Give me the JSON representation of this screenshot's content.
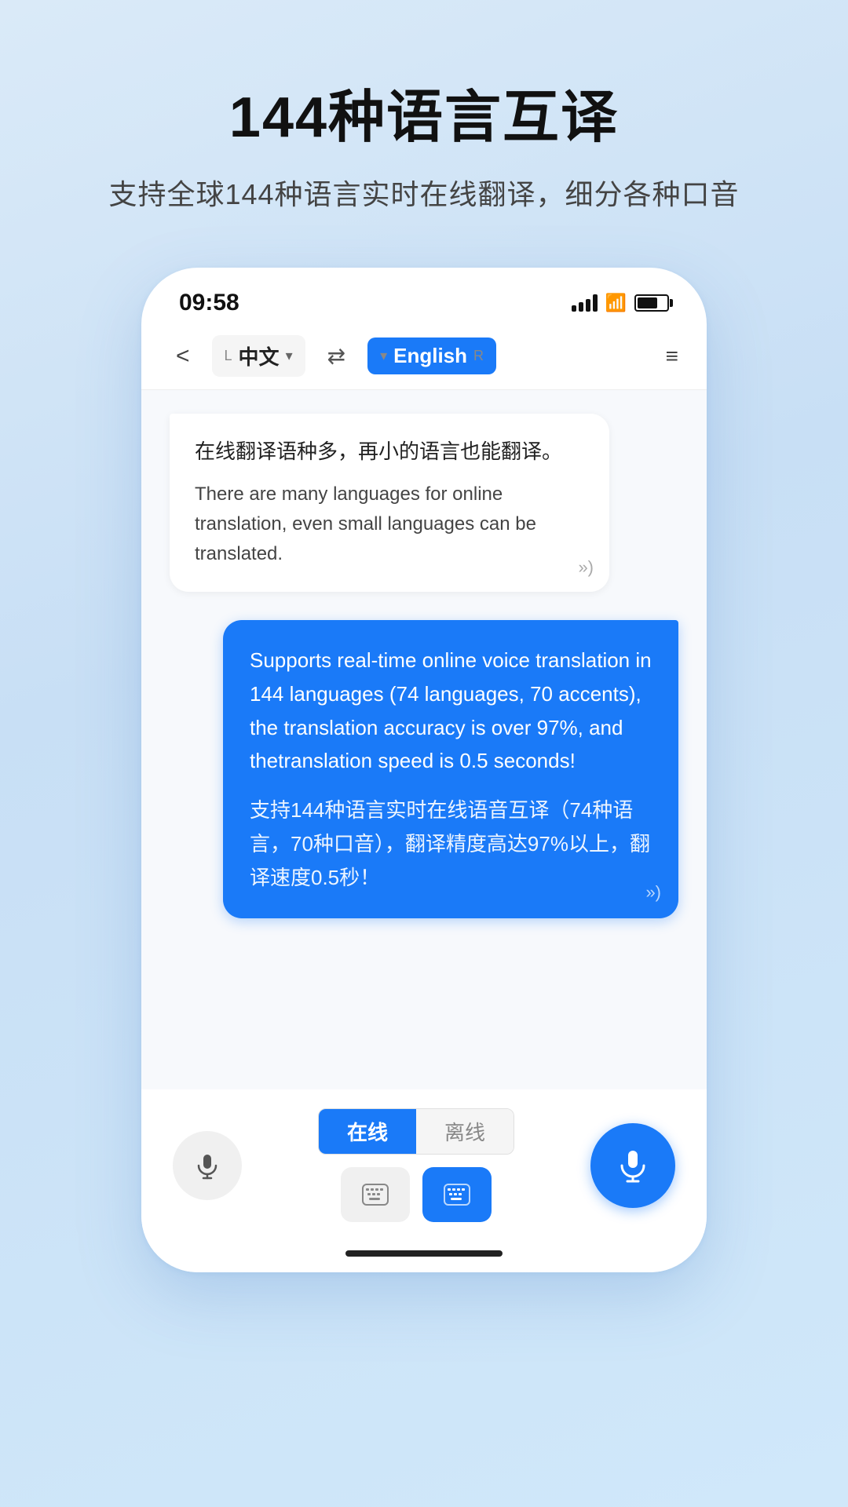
{
  "page": {
    "title": "144种语言互译",
    "subtitle": "支持全球144种语言实时在线翻译，细分各种口音"
  },
  "status_bar": {
    "time": "09:58"
  },
  "nav": {
    "back_label": "<",
    "lang_left_letter": "L",
    "lang_left_name": "中文",
    "swap_label": "⇄",
    "lang_right_letter": "▾",
    "lang_right_name": "English",
    "lang_right_suffix": "R",
    "menu_label": "≡"
  },
  "bubble_left": {
    "chinese": "在线翻译语种多，再小的语言也能翻译。",
    "english": "There are many languages for online translation, even small languages can be translated.",
    "speaker": "»)"
  },
  "bubble_right": {
    "english": "Supports real-time online voice translation in 144 languages (74 languages, 70 accents), the translation accuracy is over 97%, and thetranslation speed is 0.5 seconds!",
    "chinese": "支持144种语言实时在线语音互译（74种语言，70种口音），翻译精度高达97%以上，翻译速度0.5秒！",
    "speaker": "»)"
  },
  "toolbar": {
    "tab_online": "在线",
    "tab_offline": "离线",
    "mic_icon": "🎤",
    "keyboard_icon_left": "⌨",
    "keyboard_icon_right": "⌨"
  }
}
